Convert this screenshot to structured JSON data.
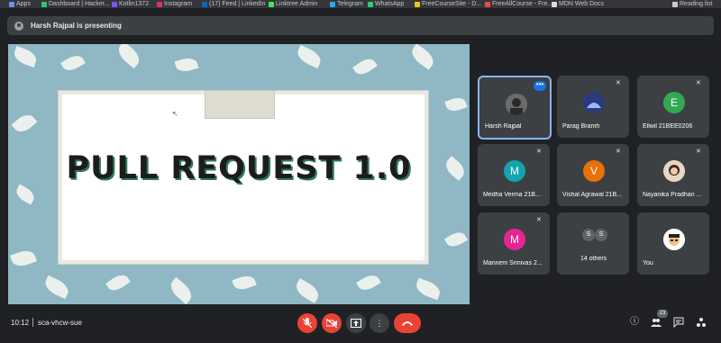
{
  "bookmarks": [
    {
      "label": "Apps",
      "color": "#6e8ef0"
    },
    {
      "label": "Dashboard | Hacker...",
      "color": "#2ec866"
    },
    {
      "label": "Kotlin1372",
      "color": "#7f52ff"
    },
    {
      "label": "Instagram",
      "color": "#e1306c"
    },
    {
      "label": "(17) Feed | LinkedIn",
      "color": "#0a66c2"
    },
    {
      "label": "Linktree Admin",
      "color": "#43e55e"
    },
    {
      "label": "Telegram",
      "color": "#2aabee"
    },
    {
      "label": "WhatsApp",
      "color": "#25d366"
    },
    {
      "label": "FreeCourseSite - D...",
      "color": "#f1c40f"
    },
    {
      "label": "FreeAllCourse - Fre...",
      "color": "#e74c3c"
    },
    {
      "label": "MDN Web Docs",
      "color": "#dddddd"
    },
    {
      "label": "Reading list",
      "color": "#cccccc"
    }
  ],
  "banner": {
    "text": "Harsh Rajpal is presenting"
  },
  "slide": {
    "title": "PULL REQUEST 1.0"
  },
  "participants": [
    {
      "name": "Harsh Rajpal",
      "avatar": "",
      "avatar_color": "#777777",
      "active": true
    },
    {
      "name": "Parag Bramh",
      "avatar": "",
      "avatar_color": "#3b4a8a"
    },
    {
      "name": "Ellwil 21BEE0206",
      "avatar": "E",
      "avatar_color": "#33a852"
    },
    {
      "name": "Medha Verma 21B...",
      "avatar": "M",
      "avatar_color": "#12a4af"
    },
    {
      "name": "Vishal Agrawal 21B...",
      "avatar": "V",
      "avatar_color": "#e8710a"
    },
    {
      "name": "Nayanika Pradhan ...",
      "avatar": "",
      "avatar_color": "#d9c4b0"
    },
    {
      "name": "Mannem Srinivas 2...",
      "avatar": "M",
      "avatar_color": "#e52592"
    },
    {
      "name": "14 others",
      "avatar": "S",
      "avatar_color": "#5f6368"
    },
    {
      "name": "You",
      "avatar": "",
      "avatar_color": "#ffffff"
    }
  ],
  "controls": {
    "time": "10:12",
    "meeting_code": "sca-vhcw-sue",
    "participant_count": "23"
  },
  "icons": {
    "mute": "mic-off-icon",
    "camera": "camera-off-icon",
    "present": "present-icon",
    "more": "more-vert-icon",
    "hangup": "call-end-icon",
    "info": "info-icon",
    "people": "people-icon",
    "chat": "chat-icon",
    "activities": "activities-icon"
  }
}
